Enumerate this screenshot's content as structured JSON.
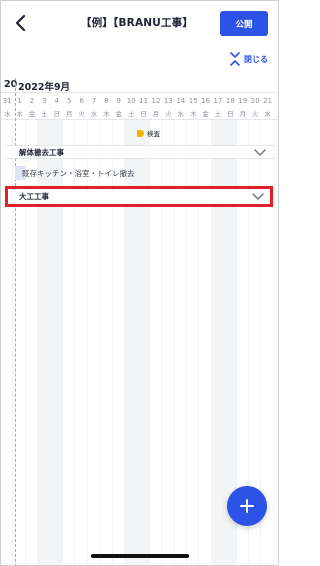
{
  "header": {
    "title": "【例】【BRANU工事】",
    "publish_label": "公開",
    "collapse_label": "閉じる"
  },
  "calendar": {
    "year_prev_fragment": "20",
    "month_label": "2022年9月",
    "days": [
      {
        "n": "31",
        "w": "水",
        "weekend": false
      },
      {
        "n": "1",
        "w": "木",
        "weekend": false
      },
      {
        "n": "2",
        "w": "金",
        "weekend": false
      },
      {
        "n": "3",
        "w": "土",
        "weekend": true
      },
      {
        "n": "4",
        "w": "日",
        "weekend": true
      },
      {
        "n": "5",
        "w": "月",
        "weekend": false
      },
      {
        "n": "6",
        "w": "火",
        "weekend": false
      },
      {
        "n": "7",
        "w": "水",
        "weekend": false
      },
      {
        "n": "8",
        "w": "木",
        "weekend": false
      },
      {
        "n": "9",
        "w": "金",
        "weekend": false
      },
      {
        "n": "10",
        "w": "土",
        "weekend": true
      },
      {
        "n": "11",
        "w": "日",
        "weekend": true
      },
      {
        "n": "12",
        "w": "月",
        "weekend": false
      },
      {
        "n": "13",
        "w": "火",
        "weekend": false
      },
      {
        "n": "14",
        "w": "水",
        "weekend": false
      },
      {
        "n": "15",
        "w": "木",
        "weekend": false
      },
      {
        "n": "16",
        "w": "金",
        "weekend": false
      },
      {
        "n": "17",
        "w": "土",
        "weekend": true
      },
      {
        "n": "18",
        "w": "日",
        "weekend": true
      },
      {
        "n": "19",
        "w": "月",
        "weekend": false
      },
      {
        "n": "20",
        "w": "火",
        "weekend": false
      },
      {
        "n": "21",
        "w": "水",
        "weekend": false
      }
    ],
    "milestone_label": "検査"
  },
  "groups": [
    {
      "label": "解体撤去工事",
      "tasks": [
        "既存キッチン・浴室・トイレ撤去"
      ]
    },
    {
      "label": "大工工事",
      "tasks": []
    }
  ],
  "colors": {
    "accent": "#2d52e6",
    "milestone": "#f5b400",
    "selection_outline": "#e0202a"
  }
}
